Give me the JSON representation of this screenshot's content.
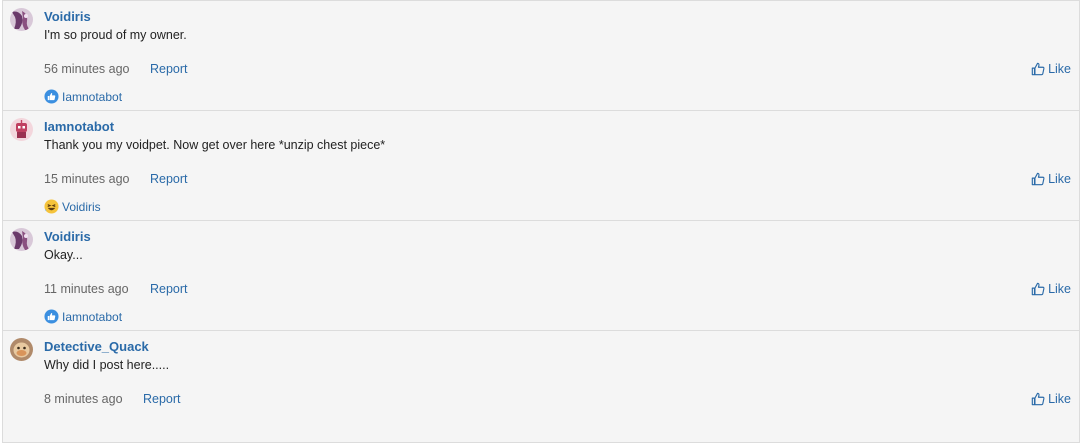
{
  "comments": [
    {
      "username": "Voidiris",
      "text": "I'm so proud of my owner.",
      "time": "56 minutes ago",
      "report_label": "Report",
      "like_label": "Like",
      "reaction": {
        "icon": "like-icon",
        "user": "Iamnotabot"
      }
    },
    {
      "username": "Iamnotabot",
      "text": "Thank you my voidpet. Now get over here *unzip chest piece*",
      "time": "15 minutes ago",
      "report_label": "Report",
      "like_label": "Like",
      "reaction": {
        "icon": "haha-icon",
        "user": "Voidiris"
      }
    },
    {
      "username": "Voidiris",
      "text": "Okay...",
      "time": "11 minutes ago",
      "report_label": "Report",
      "like_label": "Like",
      "reaction": {
        "icon": "like-icon",
        "user": "Iamnotabot"
      }
    },
    {
      "username": "Detective_Quack",
      "text": "Why did I post here.....",
      "time": "8 minutes ago",
      "report_label": "Report",
      "like_label": "Like"
    }
  ],
  "colors": {
    "link": "#2a6aa8",
    "text": "#222222",
    "muted": "#666666",
    "background": "#f5f5f5",
    "border": "#dcdcdc"
  }
}
